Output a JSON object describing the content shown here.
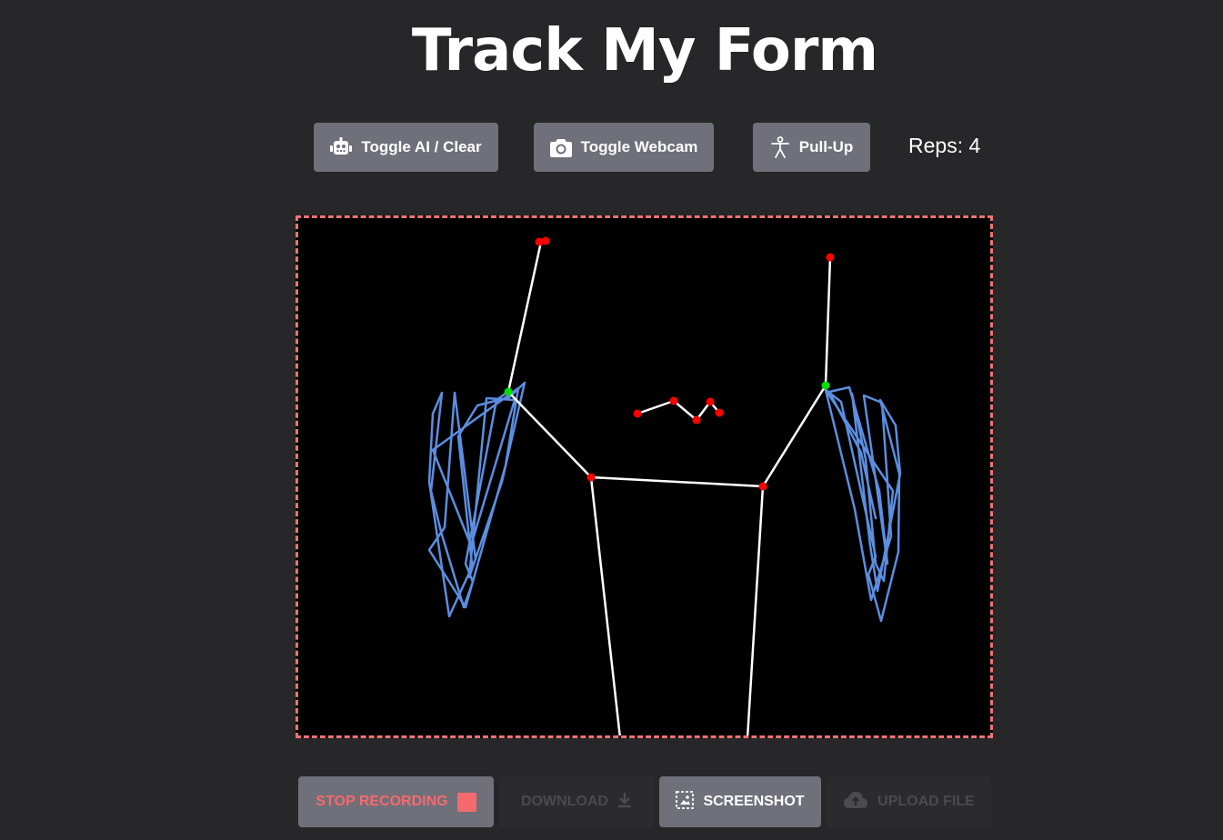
{
  "page": {
    "title": "Track My Form",
    "accent_color": "#f07373",
    "background_color": "#272729"
  },
  "toolbar": {
    "toggle_ai_label": "Toggle AI / Clear",
    "toggle_ai_icon": "robot-icon",
    "toggle_webcam_label": "Toggle Webcam",
    "toggle_webcam_icon": "camera-icon",
    "exercise_label": "Pull-Up",
    "exercise_icon": "person-icon",
    "reps_text": "Reps: 4"
  },
  "pose_view": {
    "skeleton_color": "#ffffff",
    "keypoint_color": "#ff0000",
    "wrist_color": "#00dd00",
    "trail_color": "#5b8ee0"
  },
  "recorder": {
    "stop_label": "STOP RECORDING",
    "stop_icon": "stop-square-icon",
    "download_label": "DOWNLOAD",
    "download_icon": "download-icon",
    "screenshot_label": "SCREENSHOT",
    "screenshot_icon": "screenshot-icon",
    "upload_label": "UPLOAD FILE",
    "upload_icon": "cloud-upload-icon"
  }
}
